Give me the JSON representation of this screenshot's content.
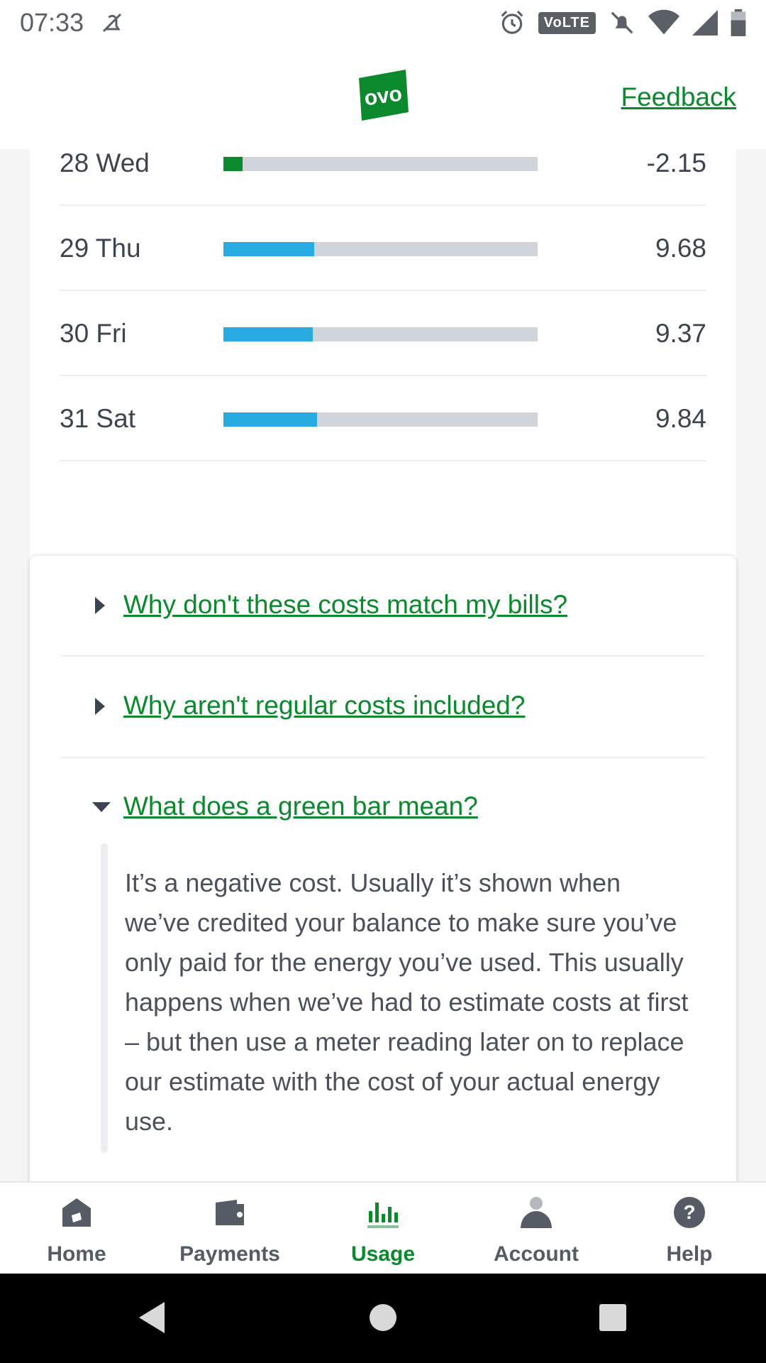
{
  "status_bar": {
    "time": "07:33",
    "volte": "VoLTE",
    "icons": [
      "do-not-disturb-off-icon",
      "alarm-icon",
      "notifications-off-icon",
      "wifi-icon",
      "cell-signal-icon",
      "battery-icon"
    ]
  },
  "header": {
    "logo": "ovo",
    "feedback": "Feedback"
  },
  "colors": {
    "brand_green": "#0a8a2c",
    "usage_blue": "#29abe2",
    "bar_track": "#d0d4db"
  },
  "usage": {
    "rows": [
      {
        "day": "28 Wed",
        "cost": "-2.15",
        "value": -2.15,
        "fill_fraction": 0.06,
        "bar_color": "#0a8a2c"
      },
      {
        "day": "29 Thu",
        "cost": "9.68",
        "value": 9.68,
        "fill_fraction": 0.29,
        "bar_color": "#29abe2"
      },
      {
        "day": "30 Fri",
        "cost": "9.37",
        "value": 9.37,
        "fill_fraction": 0.285,
        "bar_color": "#29abe2"
      },
      {
        "day": "31 Sat",
        "cost": "9.84",
        "value": 9.84,
        "fill_fraction": 0.298,
        "bar_color": "#29abe2"
      }
    ]
  },
  "faq": {
    "items": [
      {
        "question": "Why don't these costs match my bills?",
        "expanded": false
      },
      {
        "question": "Why aren't regular costs included?",
        "expanded": false
      },
      {
        "question": "What does a green bar mean?",
        "expanded": true,
        "answer": "It’s a negative cost. Usually it’s shown when we’ve credited your balance to make sure you’ve only paid for the energy you’ve used. This usually happens when we’ve had to estimate costs at first – but then use a meter reading later on to replace our estimate with the cost of your actual energy use."
      }
    ]
  },
  "bottom_nav": {
    "items": [
      {
        "label": "Home",
        "icon": "home-icon",
        "active": false
      },
      {
        "label": "Payments",
        "icon": "wallet-icon",
        "active": false
      },
      {
        "label": "Usage",
        "icon": "bar-chart-icon",
        "active": true
      },
      {
        "label": "Account",
        "icon": "person-icon",
        "active": false
      },
      {
        "label": "Help",
        "icon": "help-icon",
        "active": false
      }
    ]
  }
}
